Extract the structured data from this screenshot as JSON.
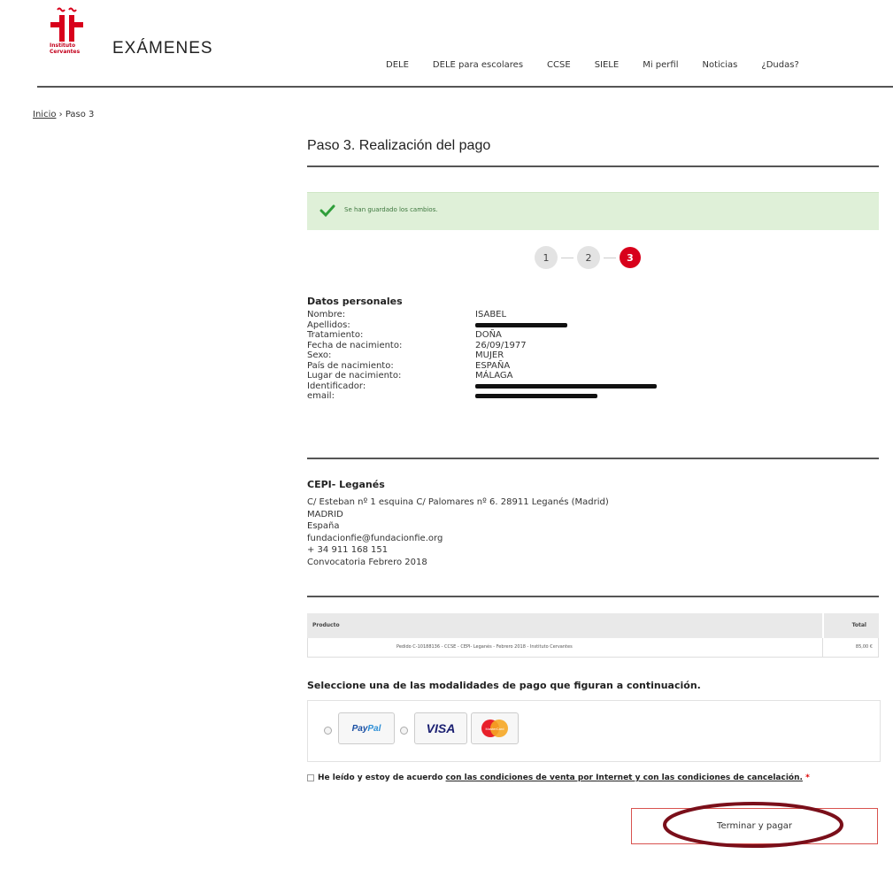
{
  "header": {
    "logo_institution": "Instituto Cervantes",
    "logo_text": "EXÁMENES",
    "nav": [
      "DELE",
      "DELE para escolares",
      "CCSE",
      "SIELE",
      "Mi perfil",
      "Noticias",
      "¿Dudas?"
    ]
  },
  "breadcrumb": {
    "home": "Inicio",
    "separator": "›",
    "current": "Paso 3"
  },
  "page_title": "Paso 3. Realización del pago",
  "alert": {
    "message": "Se han guardado los cambios."
  },
  "steps": [
    "1",
    "2",
    "3"
  ],
  "personal": {
    "title": "Datos personales",
    "rows": [
      {
        "label": "Nombre:",
        "value": "ISABEL"
      },
      {
        "label": "Apellidos:",
        "value": ""
      },
      {
        "label": "Tratamiento:",
        "value": "DOÑA"
      },
      {
        "label": "Fecha de nacimiento:",
        "value": "26/09/1977"
      },
      {
        "label": "Sexo:",
        "value": "MUJER"
      },
      {
        "label": "País de nacimiento:",
        "value": "ESPAÑA"
      },
      {
        "label": "Lugar de nacimiento:",
        "value": "MÁLAGA"
      },
      {
        "label": "Identificador:",
        "value": ""
      },
      {
        "label": "email:",
        "value": ""
      }
    ]
  },
  "center": {
    "title": "CEPI- Leganés",
    "lines": [
      "C/ Esteban nº 1 esquina C/ Palomares nº 6. 28911 Leganés (Madrid)",
      "MADRID",
      "España",
      "fundacionfie@fundacionfie.org",
      "+ 34 911 168 151",
      "Convocatoria Febrero 2018"
    ]
  },
  "table": {
    "col_product": "Producto",
    "col_total": "Total",
    "row_product": "Pedido C-10188136 - CCSE - CEPI- Leganés - Febrero 2018 - Instituto Cervantes",
    "row_total": "85,00 €"
  },
  "payment": {
    "title": "Seleccione una de las modalidades de pago que figuran a continuación.",
    "paypal_1": "Pay",
    "paypal_2": "Pal",
    "visa": "VISA",
    "mastercard": "MasterCard"
  },
  "terms": {
    "prefix": "He leído y estoy de acuerdo ",
    "link": "con las condiciones de venta por Internet y con las condiciones de cancelación.",
    "required": "*"
  },
  "submit_label": "Terminar y pagar",
  "colors": {
    "brand_red": "#d8001b",
    "success_bg": "#dff0d8",
    "annotation": "#7a0f1a"
  }
}
